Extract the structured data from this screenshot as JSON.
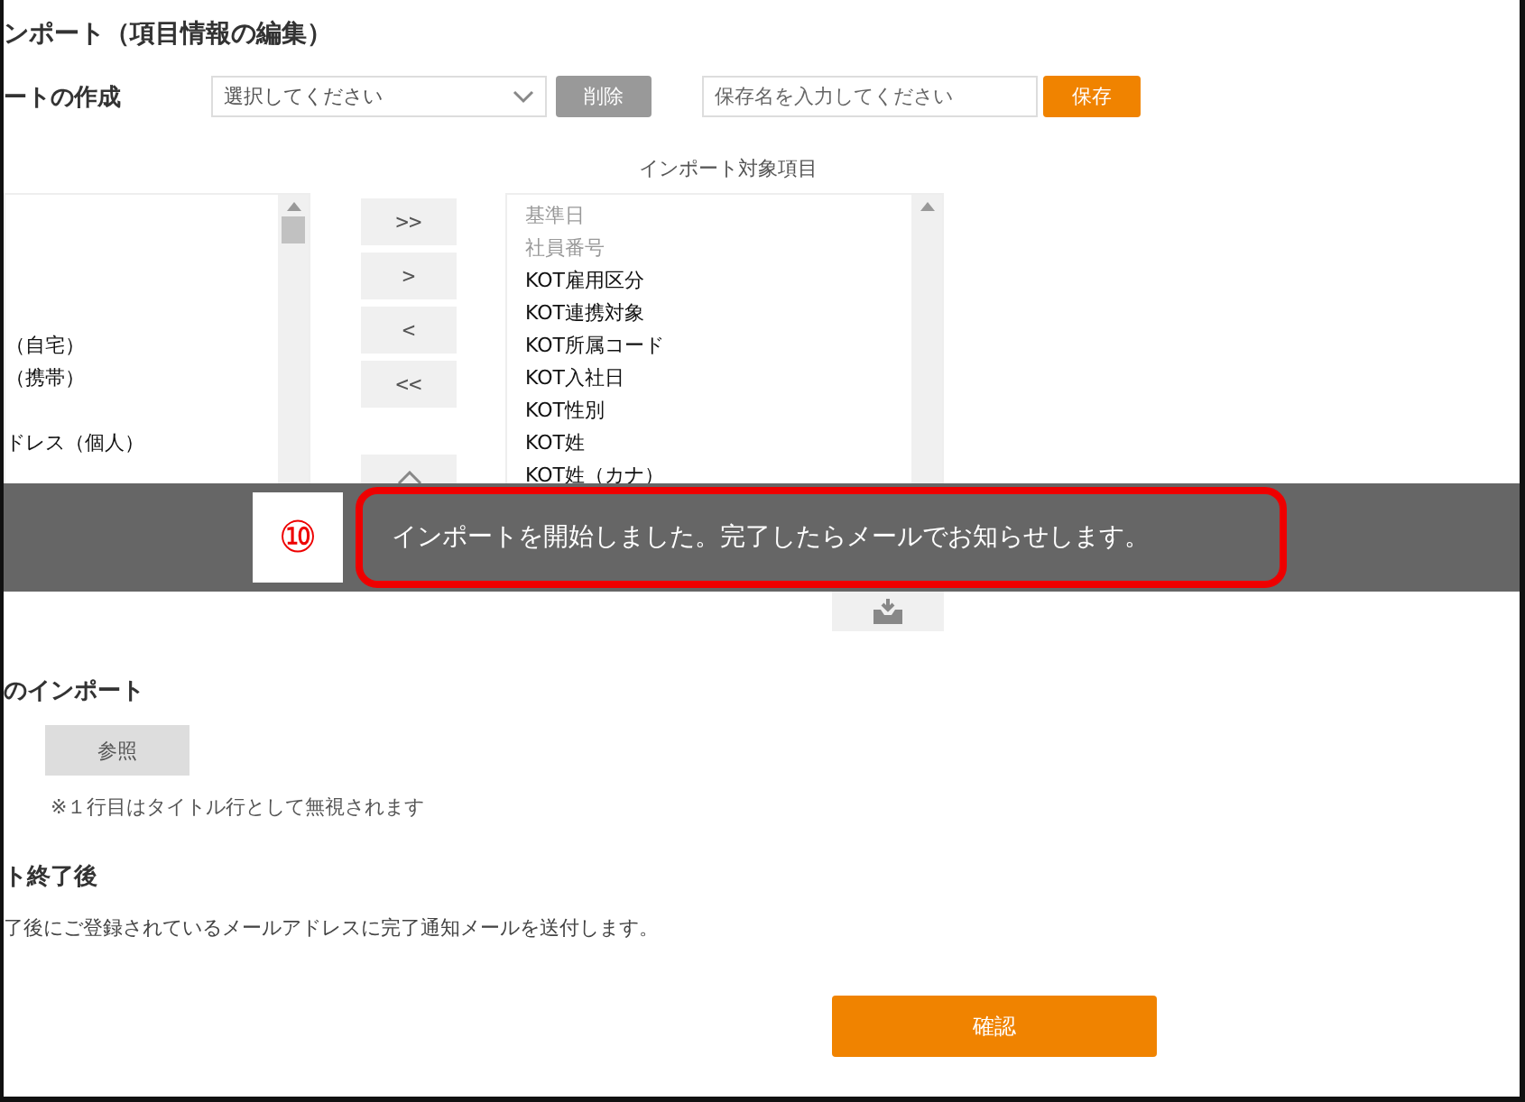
{
  "title": "ンポート（項目情報の編集）",
  "template_row": {
    "label": "ートの作成",
    "select": {
      "placeholder": "選択してください"
    },
    "delete_button": "削除",
    "name_field": {
      "placeholder": "保存名を入力してください"
    },
    "save_button": "保存"
  },
  "transfer": {
    "right_heading": "インポート対象項目",
    "left_items": [
      "（自宅）",
      "（携帯）",
      "ドレス（個人）"
    ],
    "move_buttons": [
      ">>",
      ">",
      "<",
      "<<"
    ],
    "right_items": [
      {
        "label": "基準日",
        "disabled": true
      },
      {
        "label": "社員番号",
        "disabled": true
      },
      {
        "label": "KOT雇用区分",
        "disabled": false
      },
      {
        "label": "KOT連携対象",
        "disabled": false
      },
      {
        "label": "KOT所属コード",
        "disabled": false
      },
      {
        "label": "KOT入社日",
        "disabled": false
      },
      {
        "label": "KOT性別",
        "disabled": false
      },
      {
        "label": "KOT姓",
        "disabled": false
      },
      {
        "label": "KOT姓（カナ）",
        "disabled": false
      }
    ]
  },
  "file_section": {
    "heading": "のインポート",
    "browse_button": "参照",
    "note": "※１行目はタイトル行として無視されます"
  },
  "after_section": {
    "heading": "ト終了後",
    "text": "了後にご登録されているメールアドレスに完了通知メールを送付します。"
  },
  "confirm_button": "確認",
  "toast": {
    "step": "⑩",
    "message": "インポートを開始しました。完了したらメールでお知らせします。"
  }
}
